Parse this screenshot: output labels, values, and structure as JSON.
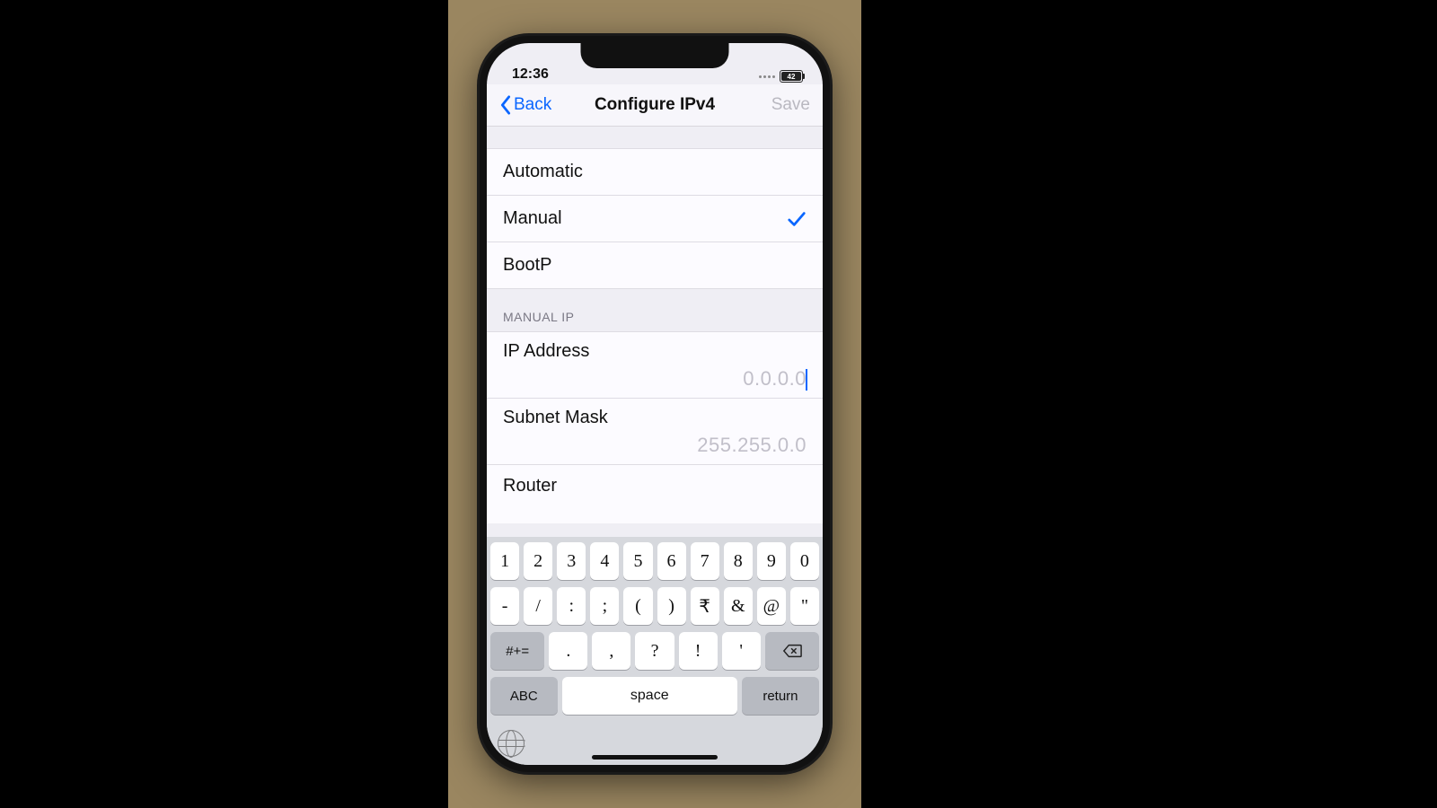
{
  "status": {
    "time": "12:36",
    "battery": "42"
  },
  "nav": {
    "back": "Back",
    "title": "Configure IPv4",
    "save": "Save"
  },
  "modes": {
    "automatic": "Automatic",
    "manual": "Manual",
    "bootp": "BootP",
    "selected": "manual"
  },
  "manual": {
    "header": "MANUAL IP",
    "ip_label": "IP Address",
    "ip_placeholder": "0.0.0.0",
    "subnet_label": "Subnet Mask",
    "subnet_placeholder": "255.255.0.0",
    "router_label": "Router"
  },
  "keyboard": {
    "row1": [
      "1",
      "2",
      "3",
      "4",
      "5",
      "6",
      "7",
      "8",
      "9",
      "0"
    ],
    "row2": [
      "-",
      "/",
      ":",
      ";",
      "(",
      ")",
      "₹",
      "&",
      "@",
      "\""
    ],
    "row3_mod": "#+=",
    "row3": [
      ".",
      ",",
      "?",
      "!",
      "'"
    ],
    "abc": "ABC",
    "space": "space",
    "return": "return"
  }
}
